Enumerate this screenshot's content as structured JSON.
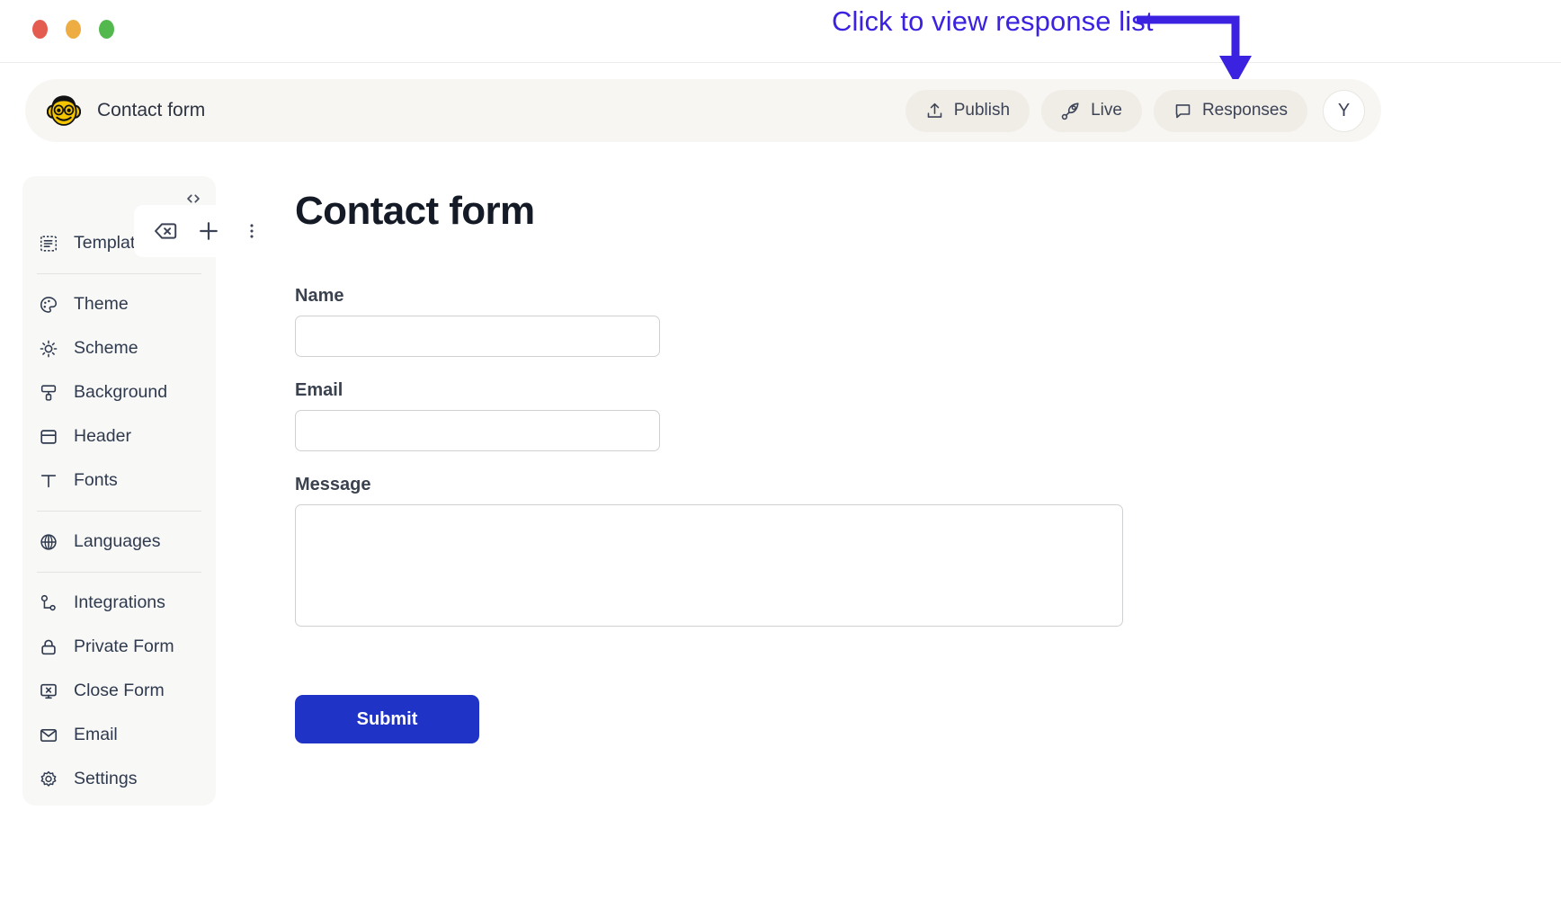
{
  "window": {
    "traffic_lights": [
      "close",
      "minimize",
      "maximize"
    ]
  },
  "annotation": {
    "text": "Click to view response list",
    "color": "#3a22e0",
    "arrow": "elbow-arrow-down-right",
    "points_to": "Responses"
  },
  "toolbar": {
    "brand_logo_icon": "monkey-face-icon",
    "title": "Contact form",
    "buttons": [
      {
        "label": "Publish",
        "icon": "upload-icon"
      },
      {
        "label": "Live",
        "icon": "rocket-icon"
      },
      {
        "label": "Responses",
        "icon": "chat-bubble-icon"
      }
    ],
    "avatar_initial": "Y",
    "pill_bg": "#f0ede6",
    "bar_bg": "#f7f6f3"
  },
  "sidebar": {
    "code_icon": "code-brackets-icon",
    "bg": "#f8f8f7",
    "groups": [
      {
        "items": [
          {
            "label": "Templates",
            "icon": "template-list-icon"
          }
        ]
      },
      {
        "items": [
          {
            "label": "Theme",
            "icon": "palette-icon"
          },
          {
            "label": "Scheme",
            "icon": "sun-brightness-icon"
          },
          {
            "label": "Background",
            "icon": "paint-roller-icon"
          },
          {
            "label": "Header",
            "icon": "header-layout-icon"
          },
          {
            "label": "Fonts",
            "icon": "text-type-icon"
          }
        ]
      },
      {
        "items": [
          {
            "label": "Languages",
            "icon": "globe-icon"
          }
        ]
      },
      {
        "items": [
          {
            "label": "Integrations",
            "icon": "integrations-nodes-icon"
          },
          {
            "label": "Private Form",
            "icon": "lock-icon"
          },
          {
            "label": "Close Form",
            "icon": "monitor-x-icon"
          },
          {
            "label": "Email",
            "icon": "envelope-icon"
          },
          {
            "label": "Settings",
            "icon": "gear-icon"
          }
        ]
      }
    ]
  },
  "block_toolbar": {
    "buttons": [
      {
        "name": "delete",
        "icon": "backspace-delete-icon"
      },
      {
        "name": "add",
        "icon": "plus-icon"
      },
      {
        "name": "more",
        "icon": "more-vertical-icon"
      }
    ]
  },
  "form": {
    "title": "Contact form",
    "fields": [
      {
        "label": "Name",
        "value": "",
        "placeholder": "",
        "type": "text"
      },
      {
        "label": "Email",
        "value": "",
        "placeholder": "",
        "type": "text"
      },
      {
        "label": "Message",
        "value": "",
        "placeholder": "",
        "type": "textarea"
      }
    ],
    "submit_label": "Submit",
    "submit_color": "#2033c7"
  }
}
